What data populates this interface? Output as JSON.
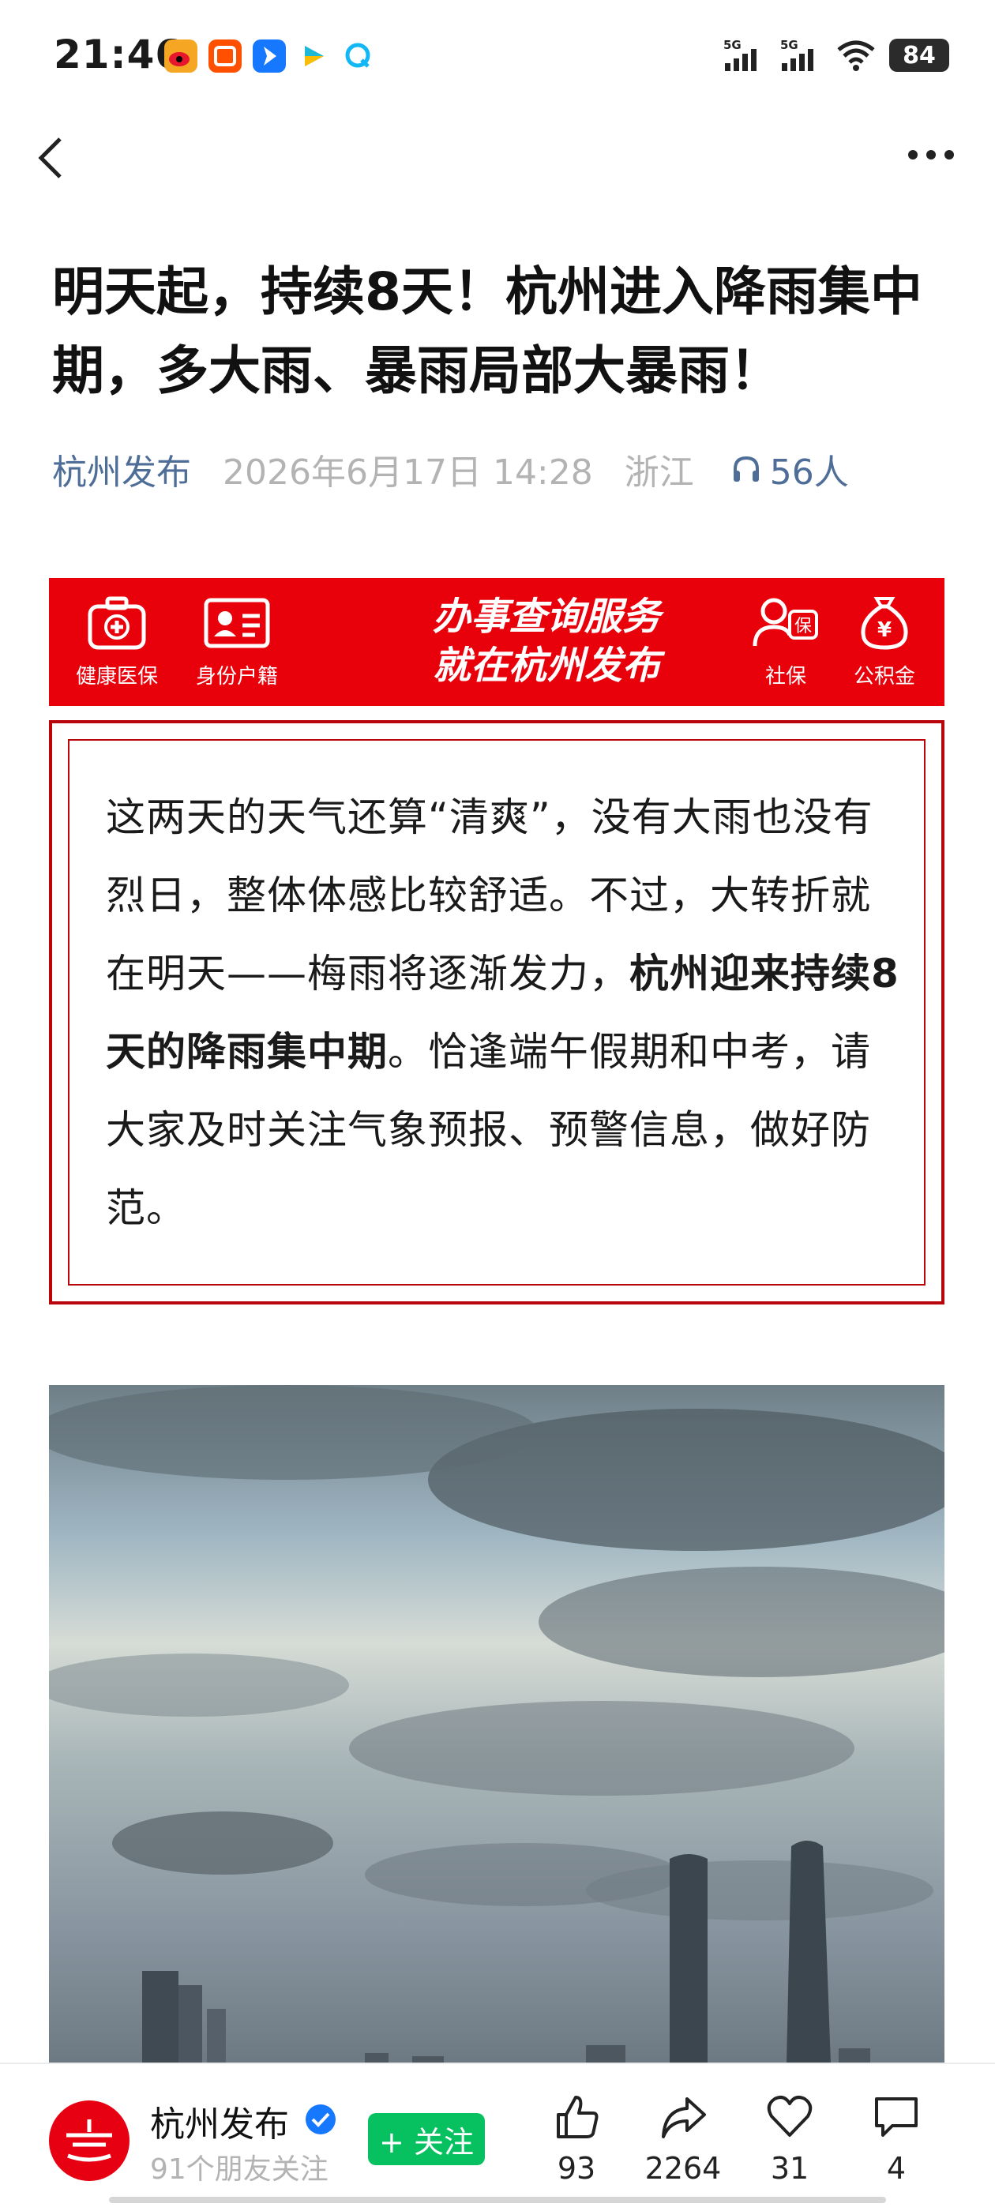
{
  "status_bar": {
    "time": "21:46",
    "notification_icons": [
      "weibo-icon",
      "taobao-icon",
      "bird-icon",
      "play-icon",
      "qq-icon"
    ],
    "signal_1": "5G",
    "signal_2": "5G",
    "battery": "84"
  },
  "nav": {
    "back_icon": "chevron-left-icon",
    "more_icon": "more-dots-icon"
  },
  "article": {
    "title": "明天起，持续8天！杭州进入降雨集中期，多大雨、暴雨局部大暴雨！",
    "author": "杭州发布",
    "date": "2026年6月17日 14:28",
    "region": "浙江",
    "listeners": "56人"
  },
  "banner": {
    "services": [
      {
        "label": "健康医保",
        "icon": "medical-kit-icon"
      },
      {
        "label": "身份户籍",
        "icon": "id-card-icon"
      },
      {
        "label": "社保",
        "icon": "social-security-icon"
      },
      {
        "label": "公积金",
        "icon": "money-bag-icon"
      }
    ],
    "slogan_line1": "办事查询服务",
    "slogan_line2": "就在杭州发布",
    "badge_char": "保",
    "currency_char": "¥"
  },
  "intro": {
    "part1": "这两天的天气还算“清爽”，没有大雨也没有烈日，整体体感比较舒适。不过，大转折就在明天——梅雨将逐渐发力，",
    "bold": "杭州迎来持续8天的降雨集中期",
    "part2": "。恰逢端午假期和中考，请大家及时关注气象预报、预警信息，做好防范。"
  },
  "bottom_bar": {
    "account_name": "杭州发布",
    "follower_text": "91个朋友关注",
    "follow_label": "+ 关注",
    "likes": "93",
    "shares": "2264",
    "favorites": "31",
    "comments": "4"
  },
  "colors": {
    "accent_red": "#e8000b",
    "border_red": "#b8060c",
    "link_blue": "#4e6e98",
    "follow_green": "#07c160"
  }
}
